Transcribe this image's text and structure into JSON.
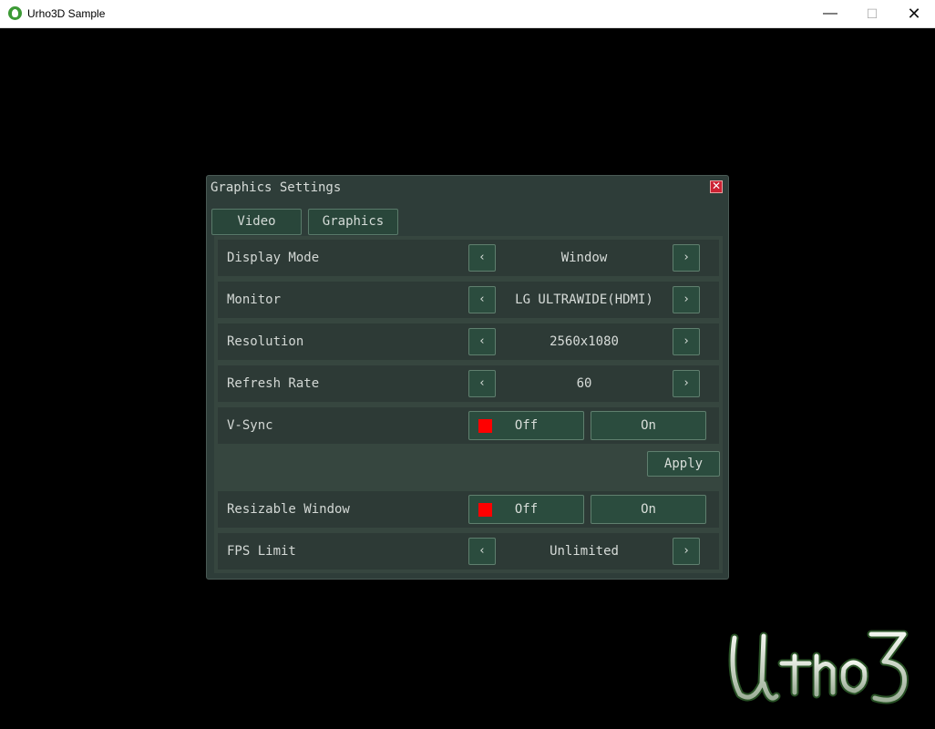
{
  "window": {
    "title": "Urho3D Sample"
  },
  "dialog": {
    "title": "Graphics Settings",
    "tabs": [
      {
        "label": "Video"
      },
      {
        "label": "Graphics"
      }
    ],
    "rows": {
      "display_mode": {
        "label": "Display Mode",
        "value": "Window"
      },
      "monitor": {
        "label": "Monitor",
        "value": "LG ULTRAWIDE(HDMI)"
      },
      "resolution": {
        "label": "Resolution",
        "value": "2560x1080"
      },
      "refresh_rate": {
        "label": "Refresh Rate",
        "value": "60"
      },
      "vsync": {
        "label": "V-Sync",
        "off": "Off",
        "on": "On"
      },
      "resizable": {
        "label": "Resizable Window",
        "off": "Off",
        "on": "On"
      },
      "fps_limit": {
        "label": "FPS Limit",
        "value": "Unlimited"
      }
    },
    "apply_label": "Apply",
    "arrow_left": "‹",
    "arrow_right": "›",
    "close_glyph": "✕"
  },
  "logo": {
    "text": "Urho3D"
  },
  "colors": {
    "accent": "#2b4c3e",
    "indicator": "#ff0000",
    "dialog_bg": "#2e3d39"
  }
}
